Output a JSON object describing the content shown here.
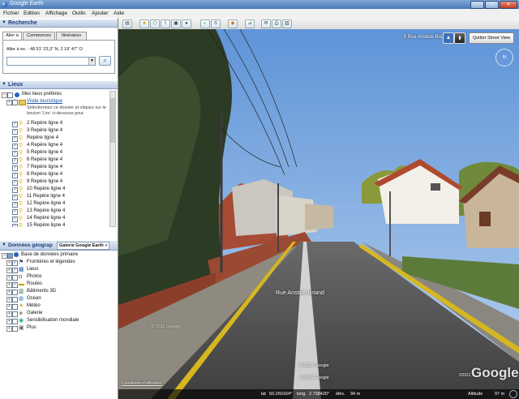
{
  "window": {
    "title": "Google Earth"
  },
  "menu": [
    "Fichier",
    "Edition",
    "Affichage",
    "Outils",
    "Ajouter",
    "Aide"
  ],
  "search": {
    "section_title": "Recherche",
    "tabs": [
      "Aller à",
      "Commerces",
      "Itinéraires"
    ],
    "hint": "Aller à ex. : 48 51' 23,3\" N, 2 19' 47\" O",
    "input_value": "",
    "search_icon": "magnifier-icon"
  },
  "places": {
    "section_title": "Lieux",
    "my_places": "Mes lieux préférés",
    "tour": "Visite touristique",
    "tour_desc": "Sélectionnez ce dossier et cliquez sur le bouton 'Lire' ci-dessous pour",
    "items": [
      "2 Repère ligne 4",
      "3 Repère ligne 4",
      "Repère ligne 4",
      "4 Repère ligne 4",
      "5  Repère ligne 4",
      "6 Repère ligne 4",
      "7 Repère ligne 4",
      "8 Repère ligne 4",
      "9 Repère ligne 4",
      "10 Repère ligne 4",
      "11 Repère ligne 4",
      "12  Repère ligne 4",
      "13  Repère ligne 4",
      "14 Repère ligne 4",
      "15  Repère ligne 4"
    ]
  },
  "layers": {
    "section_title": "Données géograp",
    "gallery_button": "Galerie Google Earth",
    "gallery_arrows": "»",
    "root": "Base de données primaire",
    "items": [
      "Frontières et légendes",
      "Lieux",
      "Photos",
      "Routes",
      "Bâtiments 3D",
      "Océan",
      "Météo",
      "Galerie",
      "Sensibilisation mondiale",
      "Plus"
    ],
    "checked": [
      true,
      true,
      false,
      true,
      false,
      false,
      false,
      false,
      false,
      false
    ]
  },
  "viewport": {
    "address": "9 Rue Aristide Briand",
    "quit_button": "Quitter Street View",
    "road_label": "Rue Aristide Briand",
    "copyright1": "© 2011 Google",
    "copyright2": "© 2011 Google",
    "copyright3": "© 2011 Google",
    "logo": "Google",
    "logo_prefix": "©2011",
    "terms": "Conditions d'utilisation"
  },
  "status": {
    "lat_label": "lat",
    "lat": "50.260164°",
    "lon_label": "long",
    "lon": "2.738420°",
    "elev_label": "élév.",
    "elev": "94 m",
    "alt_label": "Altitude",
    "alt": "97 m"
  },
  "colors": {
    "sky": "#8fb6e6",
    "accent": "#1d3f7a"
  }
}
